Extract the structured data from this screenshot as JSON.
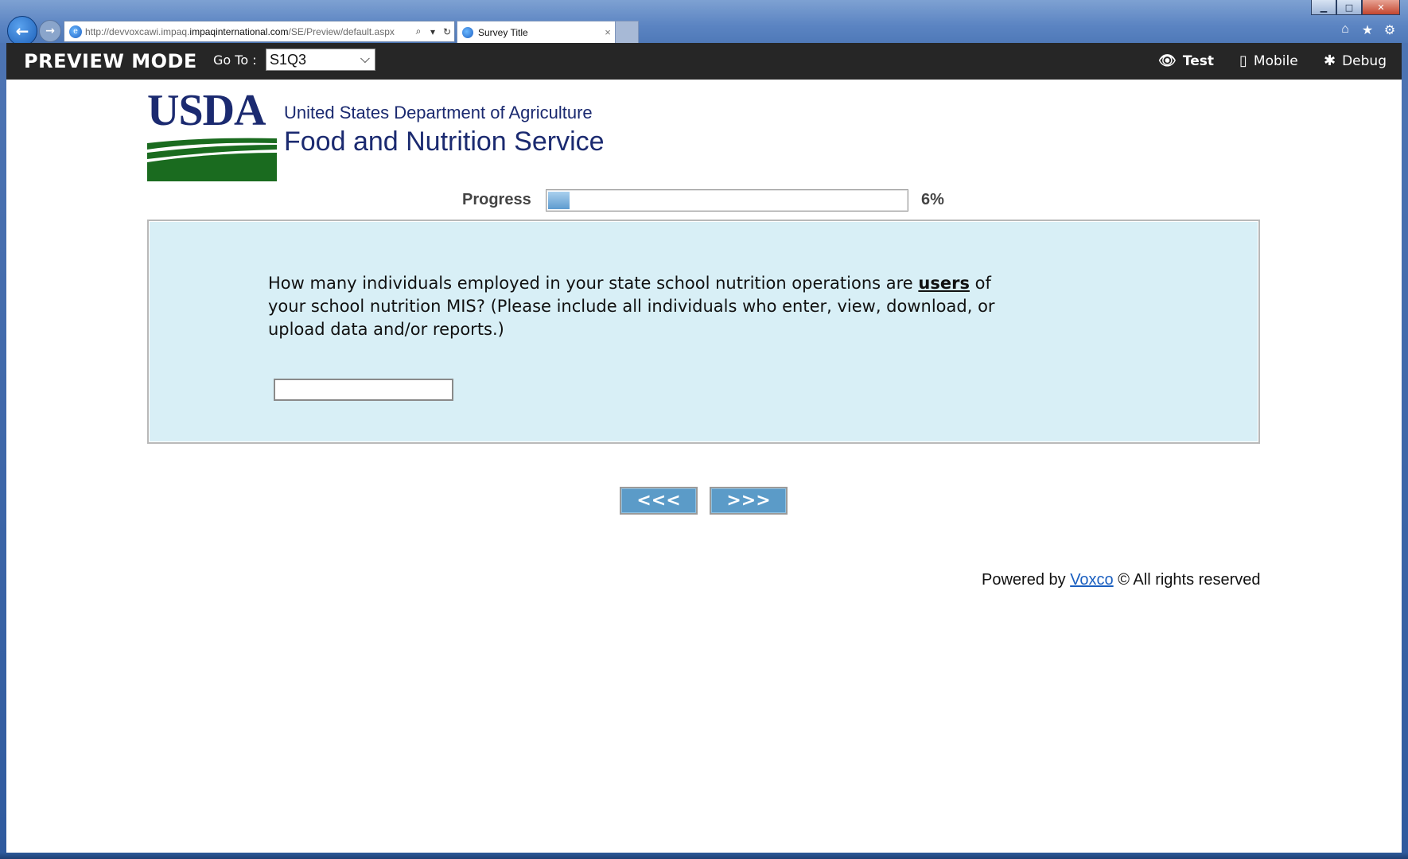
{
  "browser": {
    "window_controls": {
      "minimize": "▁",
      "maximize": "□",
      "close": "✕"
    },
    "back_icon": "arrow-left-icon",
    "forward_icon": "arrow-right-icon",
    "address": {
      "url_prefix": "http://devvoxcawi.impaq.",
      "url_domain": "impaqinternational.com",
      "url_path": "/SE/Preview/default.aspx"
    },
    "tab": {
      "title": "Survey Title",
      "close": "×"
    }
  },
  "preview_bar": {
    "title": "PREVIEW MODE",
    "goto_label": "Go To :",
    "goto_value": "S1Q3",
    "modes": {
      "test": "Test",
      "mobile": "Mobile",
      "debug": "Debug"
    }
  },
  "logo": {
    "acronym": "USDA",
    "department": "United States Department of Agriculture",
    "agency": "Food and Nutrition Service"
  },
  "progress": {
    "label": "Progress",
    "percent_text": "6%",
    "fraction": 0.06
  },
  "question": {
    "text_before": "How many individuals employed in your state school nutrition operations are ",
    "emphasis": "users",
    "text_after": " of your school nutrition MIS? (Please include all individuals who enter, view, download, or upload data and/or reports.)",
    "answer_value": ""
  },
  "navigation": {
    "prev_label": "<<<",
    "next_label": ">>>"
  },
  "footer": {
    "prefix": "Powered by",
    "link_text": "Voxco",
    "suffix": "© All rights reserved"
  },
  "colors": {
    "preview_bar_bg": "#262626",
    "panel_bg": "#d8eff6",
    "button_bg": "#5b9bc8",
    "logo_blue": "#1b2a70",
    "logo_green": "#1a6b1f"
  }
}
